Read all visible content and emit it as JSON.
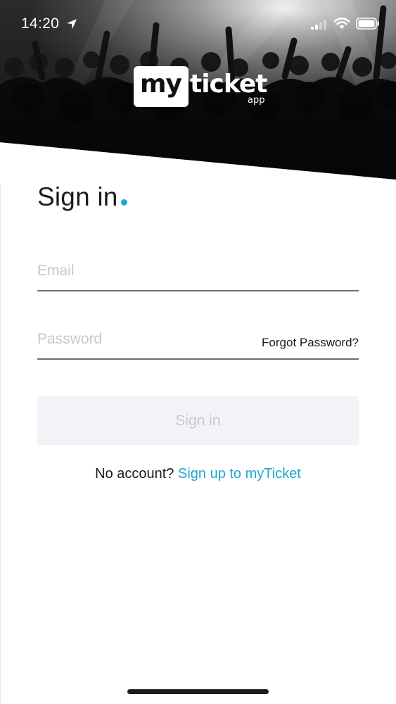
{
  "status_bar": {
    "time": "14:20",
    "icons": [
      "location-arrow-icon",
      "signal-icon",
      "wifi-icon",
      "battery-icon"
    ]
  },
  "hero": {
    "image": "concert-crowd-photo",
    "logo": {
      "primary": "my",
      "secondary": "ticket",
      "suffix": "app"
    }
  },
  "sign_in": {
    "title": "Sign in",
    "accent_color": "#1ea7cf",
    "email": {
      "placeholder": "Email",
      "value": ""
    },
    "password": {
      "placeholder": "Password",
      "value": ""
    },
    "forgot_password_label": "Forgot Password?",
    "submit_label": "Sign in",
    "no_account_text": "No account?",
    "signup_link_label": "Sign up to myTicket"
  }
}
